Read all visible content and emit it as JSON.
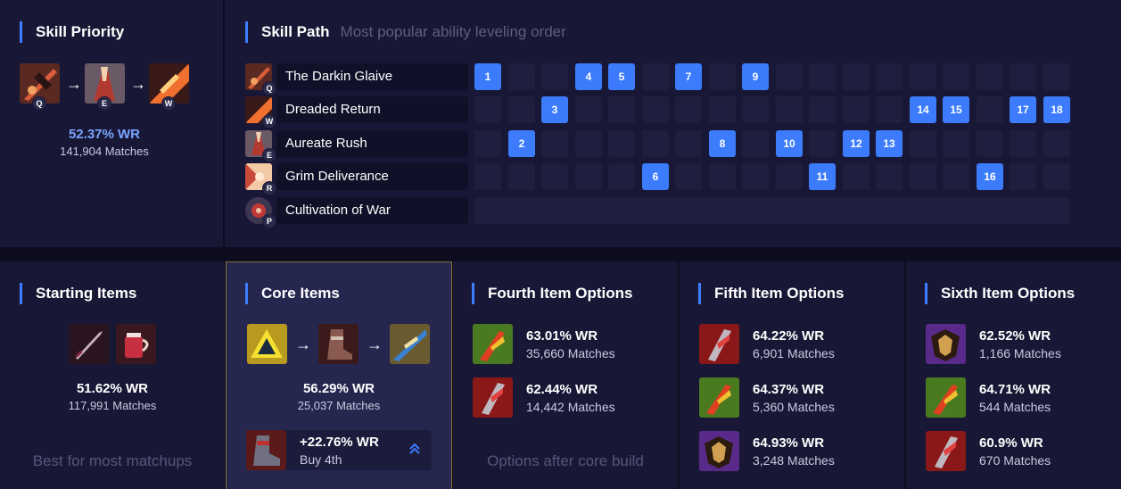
{
  "colors": {
    "accent": "#3d7dff",
    "panel": "#181836",
    "cell_active": "#3b7bfc",
    "cell_idle": "#1e1e3e"
  },
  "skill_priority": {
    "title": "Skill Priority",
    "order": [
      {
        "key": "Q",
        "icon": "darkin-glaive-icon"
      },
      {
        "key": "E",
        "icon": "aureate-rush-icon"
      },
      {
        "key": "W",
        "icon": "dreaded-return-icon"
      }
    ],
    "winrate": "52.37% WR",
    "matches": "141,904 Matches"
  },
  "skill_path": {
    "title": "Skill Path",
    "subtitle": "Most popular ability leveling order",
    "levels": 18,
    "rows": [
      {
        "name": "The Darkin Glaive",
        "key": "Q",
        "icon": "darkin-glaive-icon",
        "levels": [
          1,
          4,
          5,
          7,
          9
        ]
      },
      {
        "name": "Dreaded Return",
        "key": "W",
        "icon": "dreaded-return-icon",
        "levels": [
          3,
          14,
          15,
          17,
          18
        ]
      },
      {
        "name": "Aureate Rush",
        "key": "E",
        "icon": "aureate-rush-icon",
        "levels": [
          2,
          8,
          10,
          12,
          13
        ]
      },
      {
        "name": "Grim Deliverance",
        "key": "R",
        "icon": "grim-deliverance-icon",
        "levels": [
          6,
          11,
          16
        ]
      },
      {
        "name": "Cultivation of War",
        "key": "P",
        "icon": "cultivation-of-war-icon",
        "levels": []
      }
    ]
  },
  "starting_items": {
    "title": "Starting Items",
    "items": [
      "long-sword-icon",
      "refillable-potion-icon"
    ],
    "winrate": "51.62% WR",
    "matches": "117,991 Matches",
    "hint": "Best for most matchups"
  },
  "core_items": {
    "title": "Core Items",
    "items": [
      "triforce-icon",
      "boots-icon",
      "navori-blade-icon"
    ],
    "winrate": "56.29% WR",
    "matches": "25,037 Matches",
    "boots": {
      "icon": "mercury-treads-icon",
      "winrate": "+22.76% WR",
      "label": "Buy 4th"
    }
  },
  "fourth_items": {
    "title": "Fourth Item Options",
    "options": [
      {
        "icon": "green-claw-icon",
        "winrate": "63.01% WR",
        "matches": "35,660 Matches"
      },
      {
        "icon": "red-claw-icon",
        "winrate": "62.44% WR",
        "matches": "14,442 Matches"
      }
    ],
    "hint": "Options after core build"
  },
  "fifth_items": {
    "title": "Fifth Item Options",
    "options": [
      {
        "icon": "red-claw-icon",
        "winrate": "64.22% WR",
        "matches": "6,901 Matches"
      },
      {
        "icon": "green-claw-icon",
        "winrate": "64.37% WR",
        "matches": "5,360 Matches"
      },
      {
        "icon": "purple-shield-icon",
        "winrate": "64.93% WR",
        "matches": "3,248 Matches"
      }
    ]
  },
  "sixth_items": {
    "title": "Sixth Item Options",
    "options": [
      {
        "icon": "purple-shield-icon",
        "winrate": "62.52% WR",
        "matches": "1,166 Matches"
      },
      {
        "icon": "green-claw-icon",
        "winrate": "64.71% WR",
        "matches": "544 Matches"
      },
      {
        "icon": "red-claw-icon",
        "winrate": "60.9% WR",
        "matches": "670 Matches"
      }
    ]
  }
}
